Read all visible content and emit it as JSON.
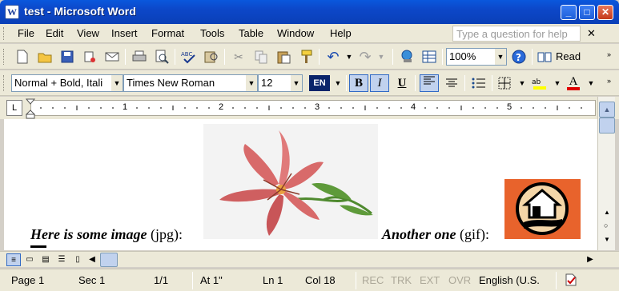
{
  "window": {
    "title": "test - Microsoft Word",
    "app_icon_letter": "W",
    "minimize": "_",
    "maximize": "□",
    "close": "✕"
  },
  "menubar": {
    "items": [
      "File",
      "Edit",
      "View",
      "Insert",
      "Format",
      "Tools",
      "Table",
      "Window",
      "Help"
    ],
    "help_placeholder": "Type a question for help",
    "close_doc": "✕"
  },
  "toolbar_standard": {
    "zoom": "100%",
    "read_label": "Read"
  },
  "toolbar_formatting": {
    "style": "Normal + Bold, Itali",
    "font": "Times New Roman",
    "size": "12",
    "language": "EN",
    "bold": "B",
    "italic": "I",
    "underline": "U",
    "font_color_letter": "A"
  },
  "ruler": {
    "tab_selector": "L",
    "numbers": [
      "1",
      "2",
      "3",
      "4",
      "5"
    ]
  },
  "document": {
    "text1_italic": "Here is some image",
    "text1_plain": " (jpg):",
    "text2_italic": "Another one",
    "text2_plain": " (gif):"
  },
  "statusbar": {
    "page": "Page 1",
    "sec": "Sec 1",
    "pages": "1/1",
    "at": "At 1\"",
    "ln": "Ln 1",
    "col": "Col 18",
    "rec": "REC",
    "trk": "TRK",
    "ext": "EXT",
    "ovr": "OVR",
    "language": "English (U.S."
  },
  "colors": {
    "title_bar": "#0a58dd",
    "gif_background": "#e8632c"
  },
  "icons": [
    "new-icon",
    "open-icon",
    "save-icon",
    "permission-icon",
    "email-icon",
    "print-icon",
    "print-preview-icon",
    "spelling-icon",
    "research-icon",
    "cut-icon",
    "copy-icon",
    "paste-icon",
    "format-painter-icon",
    "undo-icon",
    "redo-icon",
    "hyperlink-icon",
    "table-icon",
    "help-icon",
    "read-icon",
    "bullets-icon",
    "borders-icon",
    "highlight-icon",
    "font-color-icon"
  ]
}
